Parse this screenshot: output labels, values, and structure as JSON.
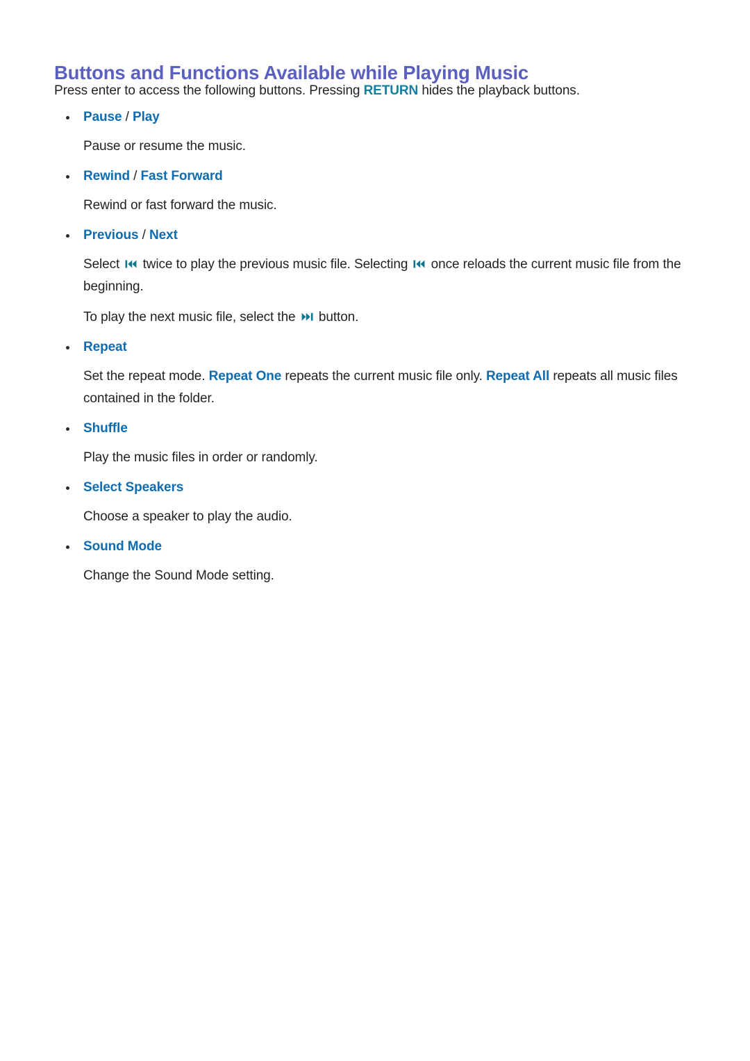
{
  "document": {
    "title": "Buttons and Functions Available while Playing Music",
    "intro_before_key": "Press enter to access the following buttons. Pressing ",
    "intro_key": "RETURN",
    "intro_after_key": " hides the playback buttons."
  },
  "colors": {
    "title": "#5b60bf",
    "heading_blue": "#0f6cb0",
    "key_teal": "#12809f",
    "body_text": "#231f20",
    "background": "#ffffff"
  },
  "icons": {
    "previous": "previous-track-icon",
    "next": "next-track-icon",
    "bullet": "bullet-dot-icon"
  },
  "sections": [
    {
      "id": "pause-play",
      "heading_primary": "Pause",
      "separator": " / ",
      "heading_secondary": "Play",
      "paragraphs": [
        {
          "text": "Pause or resume the music."
        }
      ]
    },
    {
      "id": "rewind-fast-forward",
      "heading_primary": "Rewind",
      "separator": " / ",
      "heading_secondary": "Fast Forward",
      "paragraphs": [
        {
          "text": "Rewind or fast forward the music."
        }
      ]
    },
    {
      "id": "previous-next",
      "heading_primary": "Previous",
      "separator": " / ",
      "heading_secondary": "Next",
      "paragraphs": [
        {
          "part1": "Select ",
          "part2": " twice to play the previous music file. Selecting ",
          "part3": " once reloads the current music file from the beginning."
        },
        {
          "part1": "To play the next music file, select the ",
          "part2": " button."
        }
      ]
    },
    {
      "id": "repeat",
      "heading_primary": "Repeat",
      "separator": "",
      "heading_secondary": "",
      "paragraphs": [
        {
          "part1": "Set the repeat mode. ",
          "term1": "Repeat One",
          "part2": " repeats the current music file only. ",
          "term2": "Repeat All",
          "part3": " repeats all music files contained in the folder."
        }
      ]
    },
    {
      "id": "shuffle",
      "heading_primary": "Shuffle",
      "separator": "",
      "heading_secondary": "",
      "paragraphs": [
        {
          "text": "Play the music files in order or randomly."
        }
      ]
    },
    {
      "id": "select-speakers",
      "heading_primary": "Select Speakers",
      "separator": "",
      "heading_secondary": "",
      "paragraphs": [
        {
          "text": "Choose a speaker to play the audio."
        }
      ]
    },
    {
      "id": "sound-mode",
      "heading_primary": "Sound Mode",
      "separator": "",
      "heading_secondary": "",
      "paragraphs": [
        {
          "text": "Change the Sound Mode setting."
        }
      ]
    }
  ]
}
